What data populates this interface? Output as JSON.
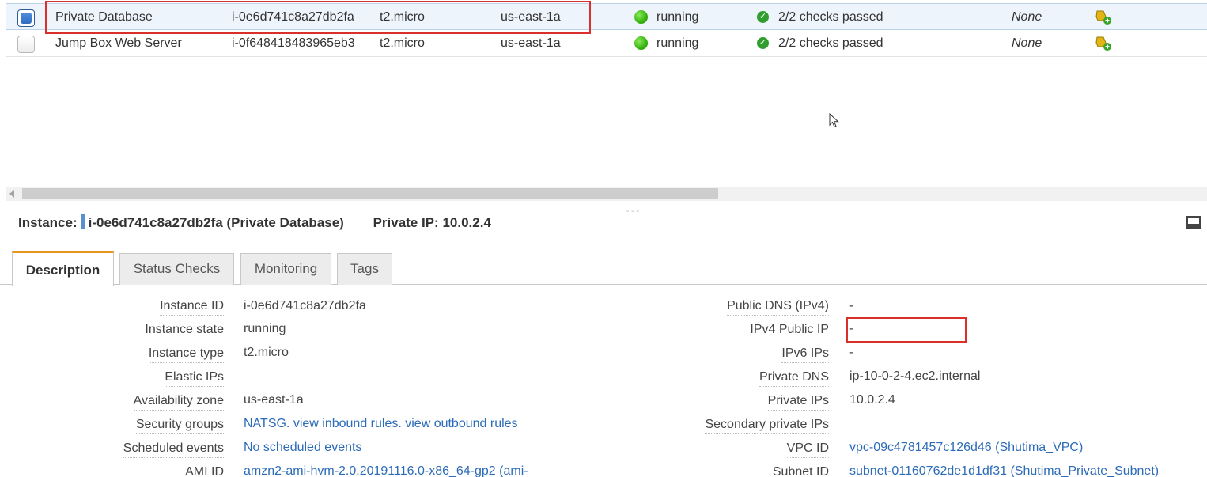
{
  "instances": [
    {
      "name": "Private Database",
      "id": "i-0e6d741c8a27db2fa",
      "type": "t2.micro",
      "az": "us-east-1a",
      "state": "running",
      "checks": "2/2 checks passed",
      "alarm": "None",
      "selected": true
    },
    {
      "name": "Jump Box Web Server",
      "id": "i-0f648418483965eb3",
      "type": "t2.micro",
      "az": "us-east-1a",
      "state": "running",
      "checks": "2/2 checks passed",
      "alarm": "None",
      "selected": false
    }
  ],
  "details": {
    "instance_label": "Instance:",
    "instance_value": "i-0e6d741c8a27db2fa (Private Database)",
    "private_ip_label": "Private IP:",
    "private_ip_value": "10.0.2.4"
  },
  "tabs": [
    {
      "label": "Description",
      "active": true
    },
    {
      "label": "Status Checks",
      "active": false
    },
    {
      "label": "Monitoring",
      "active": false
    },
    {
      "label": "Tags",
      "active": false
    }
  ],
  "description_left": [
    {
      "label": "Instance ID",
      "value": "i-0e6d741c8a27db2fa"
    },
    {
      "label": "Instance state",
      "value": "running"
    },
    {
      "label": "Instance type",
      "value": "t2.micro"
    },
    {
      "label": "Elastic IPs",
      "value": ""
    },
    {
      "label": "Availability zone",
      "value": "us-east-1a"
    },
    {
      "label": "Security groups",
      "value": "NATSG. view inbound rules. view outbound rules"
    },
    {
      "label": "Scheduled events",
      "value": "No scheduled events"
    },
    {
      "label": "AMI ID",
      "value": "amzn2-ami-hvm-2.0.20191116.0-x86_64-gp2 (ami-"
    }
  ],
  "description_right": [
    {
      "label": "Public DNS (IPv4)",
      "value": "-"
    },
    {
      "label": "IPv4 Public IP",
      "value": "-"
    },
    {
      "label": "IPv6 IPs",
      "value": "-"
    },
    {
      "label": "Private DNS",
      "value": "ip-10-0-2-4.ec2.internal"
    },
    {
      "label": "Private IPs",
      "value": "10.0.2.4"
    },
    {
      "label": "Secondary private IPs",
      "value": ""
    },
    {
      "label": "VPC ID",
      "value": "vpc-09c4781457c126d46 (Shutima_VPC)"
    },
    {
      "label": "Subnet ID",
      "value": "subnet-01160762de1d1df31 (Shutima_Private_Subnet)"
    }
  ],
  "icons": {
    "state_icon": "green-circle-icon",
    "check_icon": "green-check-icon",
    "alarm_icon": "alarm-bell-add-icon",
    "minimize_icon": "minimize-panel-icon",
    "cursor_icon": "mouse-cursor-icon"
  },
  "colors": {
    "link": "#2c6bb8",
    "selected_row": "#eef4fb",
    "active_tab_accent": "#e8961d",
    "highlight": "#d9302c",
    "running": "#36b30f"
  }
}
